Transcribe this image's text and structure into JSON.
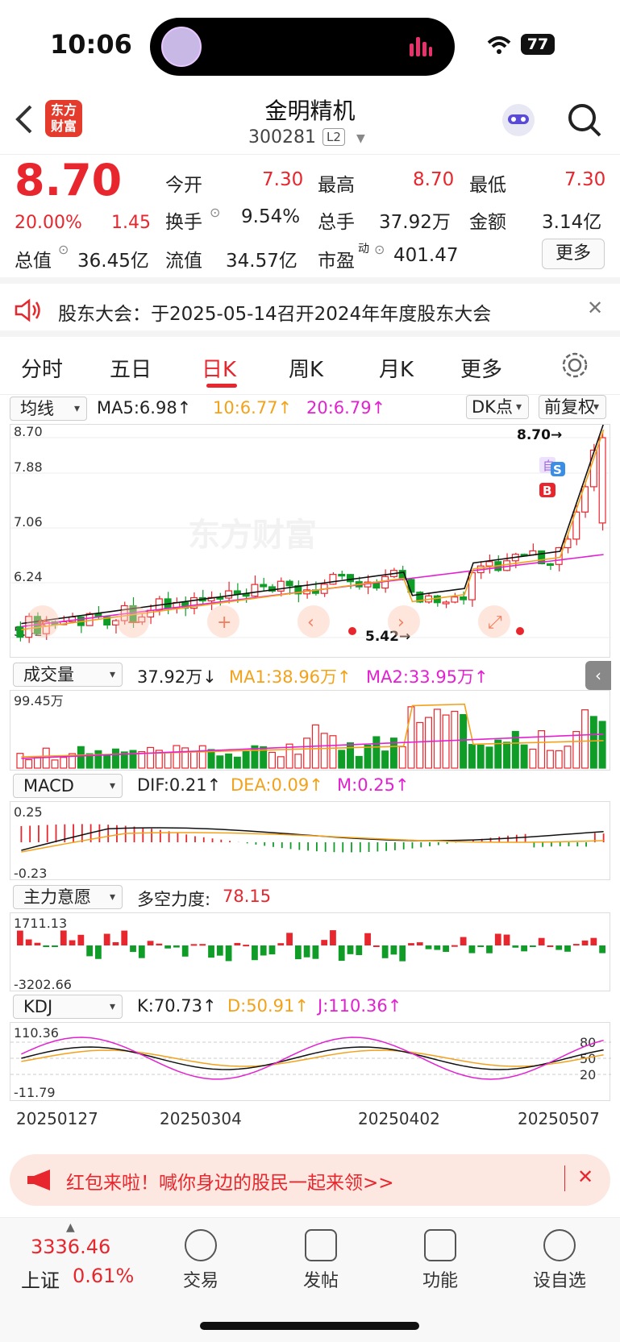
{
  "status": {
    "time": "10:06",
    "battery": "77"
  },
  "header": {
    "logo": "东方财富",
    "title": "金明精机",
    "code": "300281",
    "level": "L2"
  },
  "quote": {
    "price": "8.70",
    "change_pct": "20.00%",
    "change_amt": "1.45",
    "open_label": "今开",
    "open": "7.30",
    "high_label": "最高",
    "high": "8.70",
    "low_label": "最低",
    "low": "7.30",
    "turnover_label": "换手",
    "turnover": "9.54%",
    "volume_label": "总手",
    "volume": "37.92万",
    "amount_label": "金额",
    "amount": "3.14亿",
    "mcap_label": "总值",
    "mcap": "36.45亿",
    "float_label": "流值",
    "float": "34.57亿",
    "pe_label": "市盈",
    "pe_sup": "动",
    "pe": "401.47",
    "more": "更多"
  },
  "notice": {
    "text": "股东大会：于2025-05-14召开2024年年度股东大会"
  },
  "tabs": [
    "分时",
    "五日",
    "日K",
    "周K",
    "月K",
    "更多"
  ],
  "kline": {
    "select": "均线",
    "ma5": "MA5:6.98↑",
    "ma10": "10:6.77↑",
    "ma20": "20:6.79↑",
    "dk": "DK点",
    "adjust": "前复权",
    "y_ticks": [
      "8.70",
      "7.88",
      "7.06",
      "6.24",
      "5.42"
    ],
    "high_mark": "8.70→",
    "low_mark": "5.42→",
    "watermark": "东方财富",
    "b_mark": "B",
    "s_mark": "S",
    "self_mark": "自"
  },
  "volume": {
    "select": "成交量",
    "value": "37.92万↓",
    "ma1": "MA1:38.96万↑",
    "ma2": "MA2:33.95万↑",
    "top": "99.45万"
  },
  "macd": {
    "select": "MACD",
    "dif": "DIF:0.21↑",
    "dea": "DEA:0.09↑",
    "m": "M:0.25↑",
    "top": "0.25",
    "bottom": "-0.23"
  },
  "main_force": {
    "select": "主力意愿",
    "label": "多空力度:",
    "value": "78.15",
    "top": "1711.13",
    "bottom": "-3202.66"
  },
  "kdj": {
    "select": "KDJ",
    "k": "K:70.73↑",
    "d": "D:50.91↑",
    "j": "J:110.36↑",
    "top": "110.36",
    "bottom": "-11.79",
    "r80": "80",
    "r50": "50",
    "r20": "20"
  },
  "dates": [
    "20250127",
    "20250304",
    "20250402",
    "20250507"
  ],
  "promo": {
    "text": "红包来啦！喊你身边的股民一起来领>>"
  },
  "bottom": {
    "index_value": "3336.46",
    "index_name": "上证",
    "index_pct": "0.61%",
    "items": [
      "交易",
      "发帖",
      "功能",
      "设自选"
    ]
  },
  "colors": {
    "up": "#e8262d",
    "down": "#0f9d28",
    "ma10": "#f2a21b",
    "ma20": "#e222d0"
  }
}
